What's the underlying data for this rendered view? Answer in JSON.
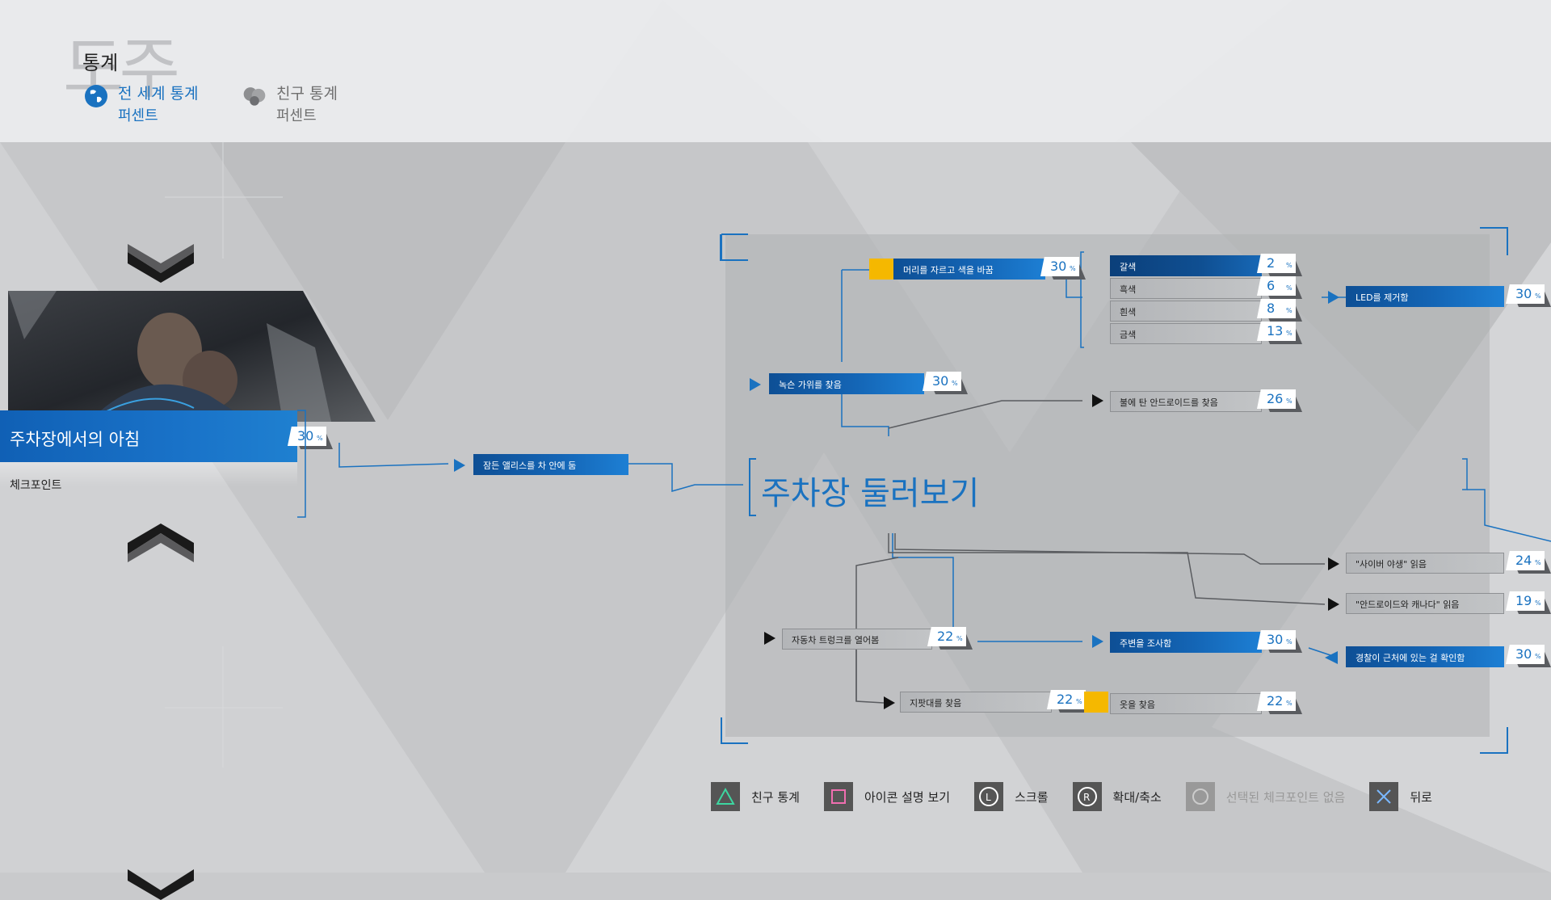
{
  "header": {
    "ghost_title": "도주",
    "title": "통계",
    "tabs": [
      {
        "label": "전 세계 통계",
        "sub": "퍼센트",
        "active": true,
        "icon": "globe-icon"
      },
      {
        "label": "친구 통계",
        "sub": "퍼센트",
        "active": false,
        "icon": "friends-icon"
      }
    ]
  },
  "chapter": {
    "title": "주차장에서의 아침",
    "percent": "30",
    "percent_symbol": "%",
    "checkpoint_label": "체크포인트"
  },
  "flowchart": {
    "main_node": "주차장 둘러보기",
    "nodes": {
      "sleeping_alice": {
        "label": "잠든 앨리스를 차 안에 둠"
      },
      "cut_hair": {
        "label": "머리를 자르고 색을 바꿈",
        "percent": "30"
      },
      "brown": {
        "label": "갈색",
        "percent": "2"
      },
      "black": {
        "label": "흑색",
        "percent": "6"
      },
      "white": {
        "label": "흰색",
        "percent": "8"
      },
      "blonde": {
        "label": "금색",
        "percent": "13"
      },
      "led": {
        "label": "LED를 제거함",
        "percent": "30"
      },
      "scissors": {
        "label": "녹슨 가위를 찾음",
        "percent": "30"
      },
      "burnt_android": {
        "label": "불에 탄 안드로이드를 찾음",
        "percent": "26"
      },
      "cyber_wild": {
        "label": "\"사이버 야생\" 읽음",
        "percent": "24"
      },
      "androids_canada": {
        "label": "\"안드로이드와 캐나다\" 읽음",
        "percent": "19"
      },
      "trunk": {
        "label": "자동차 트렁크를 열어봄",
        "percent": "22"
      },
      "look_around": {
        "label": "주변을 조사함",
        "percent": "30"
      },
      "police_check": {
        "label": "경찰이 근처에 있는 걸 확인함",
        "percent": "30"
      },
      "cane": {
        "label": "지팟대를 찾음",
        "percent": "22"
      },
      "clothes": {
        "label": "옷을 찾음",
        "percent": "22"
      }
    },
    "percent_symbol": "%"
  },
  "controls": [
    {
      "label": "친구 통계",
      "icon": "triangle-button-icon",
      "disabled": false
    },
    {
      "label": "아이콘 설명 보기",
      "icon": "square-button-icon",
      "disabled": false
    },
    {
      "label": "스크롤",
      "icon": "left-stick-icon",
      "disabled": false
    },
    {
      "label": "확대/축소",
      "icon": "right-stick-icon",
      "disabled": false
    },
    {
      "label": "선택된 체크포인트 없음",
      "icon": "circle-button-icon",
      "disabled": true
    },
    {
      "label": "뒤로",
      "icon": "cross-button-icon",
      "disabled": false
    }
  ],
  "colors": {
    "accent": "#1a72c0",
    "lock": "#f5b800",
    "background": "#c9cacc"
  }
}
